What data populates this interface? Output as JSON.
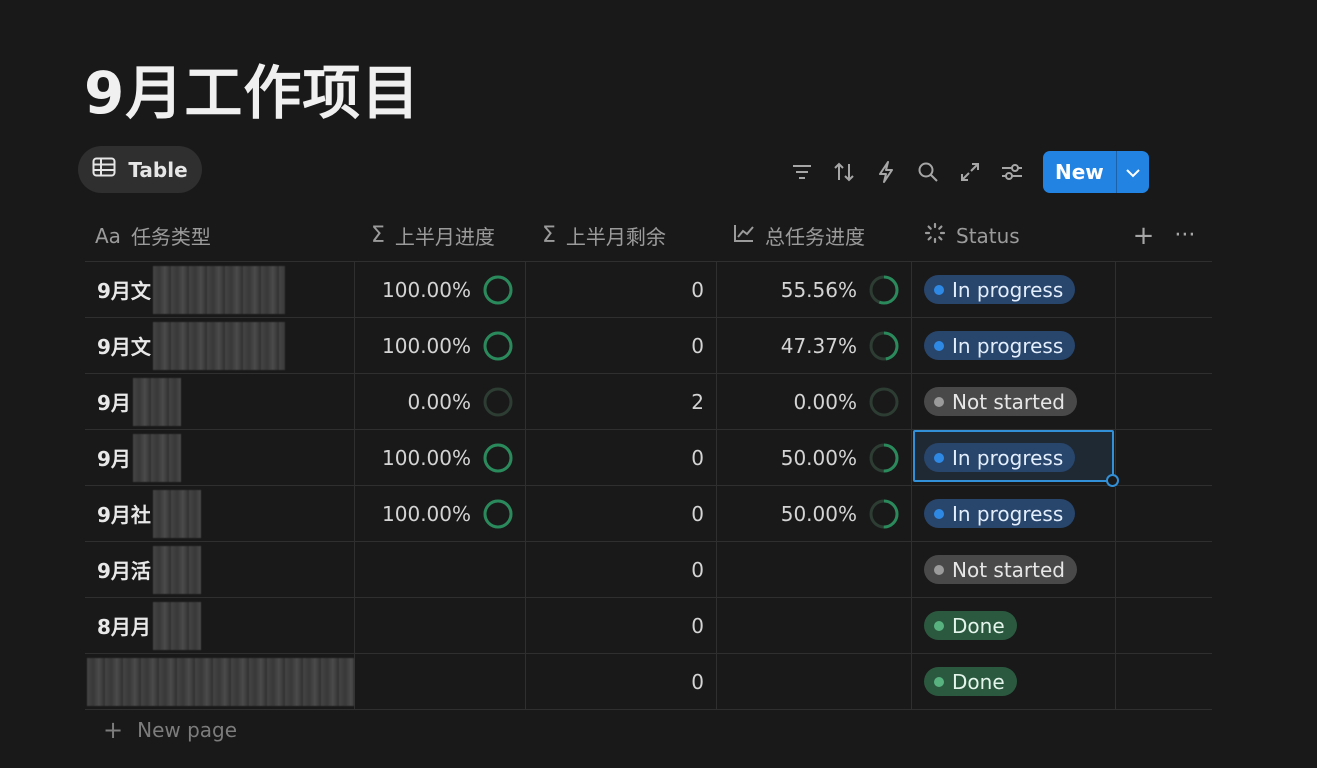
{
  "page": {
    "title": "9月工作项目"
  },
  "view_tab": {
    "label": "Table",
    "icon": "table-icon"
  },
  "toolbar": {
    "icons": [
      "filter-icon",
      "sort-icon",
      "automation-icon",
      "search-icon",
      "expand-icon",
      "settings-icon"
    ],
    "new_label": "New"
  },
  "columns": [
    {
      "label": "任务类型",
      "prefix": "Aa",
      "icon": "text-property-icon"
    },
    {
      "label": "上半月进度",
      "prefix": "Σ",
      "icon": "formula-icon"
    },
    {
      "label": "上半月剩余",
      "prefix": "Σ",
      "icon": "formula-icon"
    },
    {
      "label": "总任务进度",
      "prefix": "",
      "icon": "rollup-chart-icon"
    },
    {
      "label": "Status",
      "prefix": "",
      "icon": "status-icon"
    }
  ],
  "rows": [
    {
      "name": "9月文",
      "first_half": "100.00%",
      "first_progress": 1.0,
      "remaining": "0",
      "total": "55.56%",
      "total_progress": 0.5556,
      "status": "In progress"
    },
    {
      "name": "9月文",
      "first_half": "100.00%",
      "first_progress": 1.0,
      "remaining": "0",
      "total": "47.37%",
      "total_progress": 0.4737,
      "status": "In progress"
    },
    {
      "name": "9月",
      "first_half": "0.00%",
      "first_progress": 0.0,
      "remaining": "2",
      "total": "0.00%",
      "total_progress": 0.0,
      "status": "Not started"
    },
    {
      "name": "9月",
      "first_half": "100.00%",
      "first_progress": 1.0,
      "remaining": "0",
      "total": "50.00%",
      "total_progress": 0.5,
      "status": "In progress"
    },
    {
      "name": "9月社",
      "first_half": "100.00%",
      "first_progress": 1.0,
      "remaining": "0",
      "total": "50.00%",
      "total_progress": 0.5,
      "status": "In progress"
    },
    {
      "name": "9月活",
      "first_half": "",
      "first_progress": null,
      "remaining": "0",
      "total": "",
      "total_progress": null,
      "status": "Not started"
    },
    {
      "name": "8月月",
      "first_half": "",
      "first_progress": null,
      "remaining": "0",
      "total": "",
      "total_progress": null,
      "status": "Done"
    },
    {
      "name": "",
      "first_half": "",
      "first_progress": null,
      "remaining": "0",
      "total": "",
      "total_progress": null,
      "status": "Done"
    }
  ],
  "status_styles": {
    "In progress": {
      "bg": "#28456c",
      "dot": "#2e89e5",
      "fg": "#e3eefc"
    },
    "Not started": {
      "bg": "#494949",
      "dot": "#9b9b9b",
      "fg": "#e6e6e6"
    },
    "Done": {
      "bg": "#2b593f",
      "dot": "#58b280",
      "fg": "#e3f4ea"
    }
  },
  "colors": {
    "progress_ring": "#2a8a5c",
    "progress_track": "#2d3d33",
    "selection": "#3290d8"
  },
  "selected_cell": {
    "row": 3,
    "column": "Status"
  },
  "footer": {
    "new_page_label": "New page"
  }
}
